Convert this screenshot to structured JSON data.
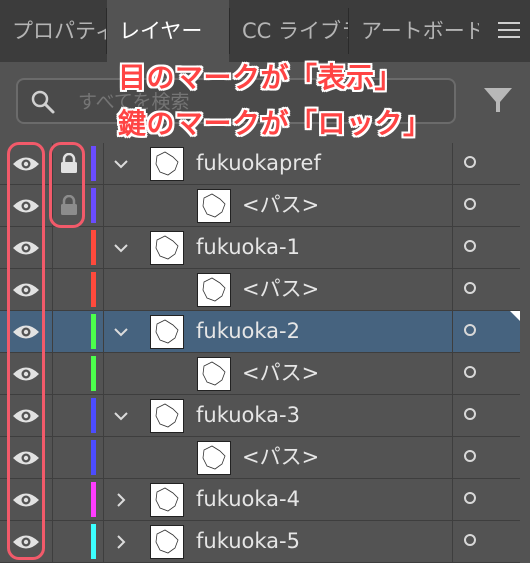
{
  "tabs": [
    {
      "label": "プロパティ",
      "active": false
    },
    {
      "label": "レイヤー",
      "active": true
    },
    {
      "label": "CC ライブラリ",
      "active": false
    },
    {
      "label": "アートボード",
      "active": false
    }
  ],
  "search": {
    "placeholder": "すべてを検索"
  },
  "annotations": {
    "line1": "目のマークが「表示」",
    "line2": "鍵のマークが「ロック」"
  },
  "colors": {
    "highlight": "#f25a6a",
    "annotation": "#ff4444",
    "selected_row": "#46637f"
  },
  "layers": [
    {
      "name": "fukuokapref",
      "level": "top",
      "expanded": true,
      "locked": "on",
      "color": "#6a4cff"
    },
    {
      "name": "<パス>",
      "level": "sub",
      "locked": "dim",
      "color": "#6a4cff"
    },
    {
      "name": "fukuoka-1",
      "level": "top",
      "expanded": true,
      "locked": "none",
      "color": "#ff4a3c"
    },
    {
      "name": "<パス>",
      "level": "sub",
      "locked": "none",
      "color": "#ff4a3c"
    },
    {
      "name": "fukuoka-2",
      "level": "top",
      "expanded": true,
      "locked": "none",
      "color": "#4cff4c",
      "selected": true
    },
    {
      "name": "<パス>",
      "level": "sub",
      "locked": "none",
      "color": "#4cff4c"
    },
    {
      "name": "fukuoka-3",
      "level": "top",
      "expanded": true,
      "locked": "none",
      "color": "#4c4cff"
    },
    {
      "name": "<パス>",
      "level": "sub",
      "locked": "none",
      "color": "#4c4cff"
    },
    {
      "name": "fukuoka-4",
      "level": "top",
      "expanded": false,
      "locked": "none",
      "color": "#ff3cff"
    },
    {
      "name": "fukuoka-5",
      "level": "top",
      "expanded": false,
      "locked": "none",
      "color": "#3cffff"
    }
  ]
}
